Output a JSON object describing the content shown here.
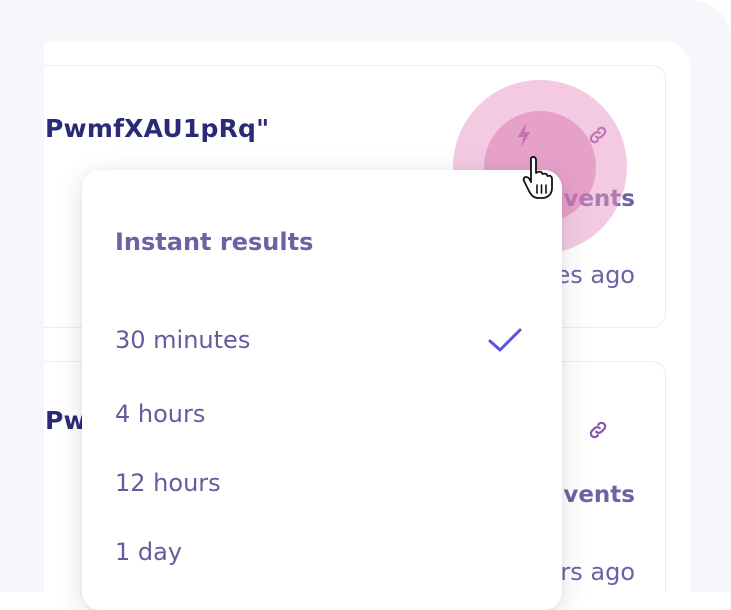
{
  "cards": [
    {
      "title": "PwmfXAU1pRq\"",
      "events_text": "vents",
      "time_text": "es ago"
    },
    {
      "title": "Pw",
      "events_text": "vents",
      "time_text": "rs ago"
    }
  ],
  "icons": {
    "bolt": "lightning-bolt-icon",
    "link": "link-icon",
    "check": "checkmark-icon",
    "cursor": "hand-pointer-cursor-icon"
  },
  "dropdown": {
    "header": "Instant results",
    "options": [
      {
        "label": "30 minutes",
        "selected": true
      },
      {
        "label": "4 hours",
        "selected": false
      },
      {
        "label": "12 hours",
        "selected": false
      },
      {
        "label": "1 day",
        "selected": false
      }
    ]
  },
  "colors": {
    "title": "#2b2a78",
    "muted_text": "#6a64a4",
    "accent_check": "#5b52e0",
    "icon_purple": "#8a54ad",
    "halo": "#e896c4"
  }
}
